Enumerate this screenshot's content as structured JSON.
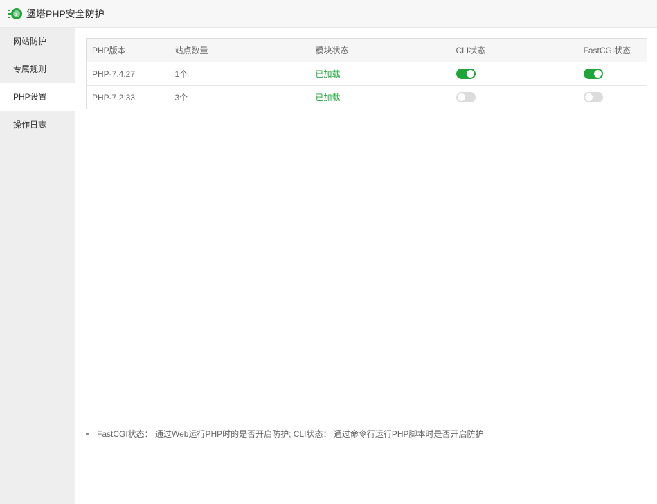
{
  "app": {
    "title": "堡塔PHP安全防护",
    "logo_icon": "bt-logo-icon",
    "accent": "#20a53a"
  },
  "sidebar": {
    "items": [
      {
        "label": "网站防护",
        "active": false
      },
      {
        "label": "专属规则",
        "active": false
      },
      {
        "label": "PHP设置",
        "active": true
      },
      {
        "label": "操作日志",
        "active": false
      }
    ]
  },
  "table": {
    "headers": [
      "PHP版本",
      "站点数量",
      "模块状态",
      "CLI状态",
      "FastCGI状态"
    ],
    "rows": [
      {
        "version": "PHP-7.4.27",
        "sites": "1个",
        "module": "已加载",
        "cli": true,
        "fastcgi": true
      },
      {
        "version": "PHP-7.2.33",
        "sites": "3个",
        "module": "已加载",
        "cli": false,
        "fastcgi": false
      }
    ]
  },
  "notes": [
    "FastCGI状态： 通过Web运行PHP时的是否开启防护; CLI状态： 通过命令行运行PHP脚本时是否开启防护"
  ]
}
